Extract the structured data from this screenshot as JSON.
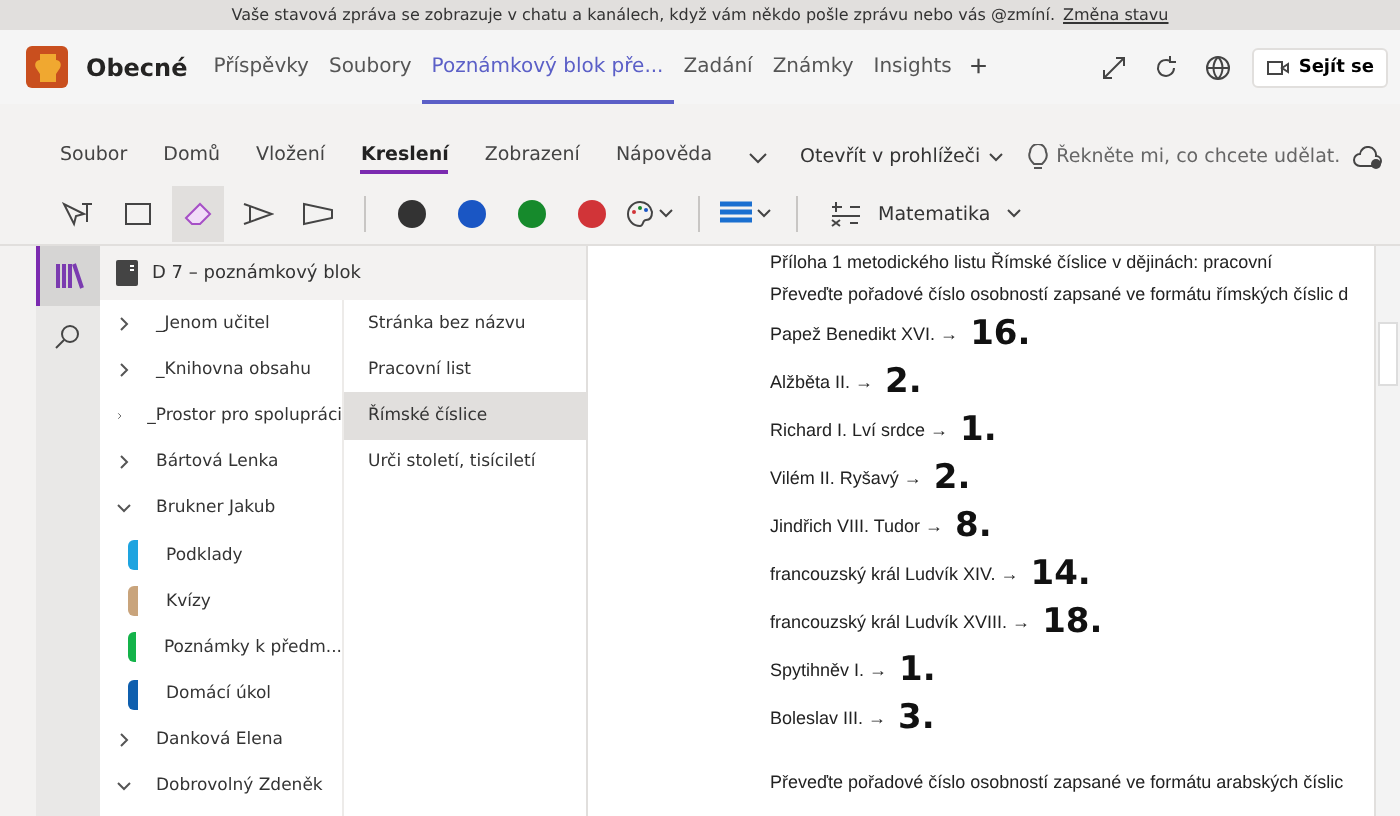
{
  "notice": {
    "text": "Vaše stavová zpráva se zobrazuje v chatu a kanálech, když vám někdo pošle zprávu nebo vás @zmíní.",
    "link": "Změna stavu"
  },
  "header": {
    "channel": "Obecné",
    "tabs": [
      {
        "label": "Příspěvky",
        "selected": false
      },
      {
        "label": "Soubory",
        "selected": false
      },
      {
        "label": "Poznámkový blok pře...",
        "selected": true
      },
      {
        "label": "Zadání",
        "selected": false
      },
      {
        "label": "Známky",
        "selected": false
      },
      {
        "label": "Insights",
        "selected": false
      }
    ],
    "add": "+",
    "meet": "Sejít se"
  },
  "ribbon": {
    "tabs": [
      {
        "label": "Soubor",
        "selected": false
      },
      {
        "label": "Domů",
        "selected": false
      },
      {
        "label": "Vložení",
        "selected": false
      },
      {
        "label": "Kreslení",
        "selected": true
      },
      {
        "label": "Zobrazení",
        "selected": false
      },
      {
        "label": "Nápověda",
        "selected": false
      }
    ],
    "open_in_browser": "Otevřít v prohlížeči",
    "tell_me": {
      "placeholder": "Řekněte mi, co chcete udělat."
    }
  },
  "toolbar": {
    "tools": [
      {
        "kind": "select",
        "selected": false
      },
      {
        "kind": "lasso",
        "selected": false
      },
      {
        "kind": "eraser",
        "selected": true
      },
      {
        "kind": "pen",
        "selected": false
      },
      {
        "kind": "highlighter",
        "selected": false
      }
    ],
    "pens": [
      {
        "color": "#333333"
      },
      {
        "color": "#1a56c4"
      },
      {
        "color": "#168a2c"
      },
      {
        "color": "#d13438"
      }
    ],
    "math": "Matematika"
  },
  "notebook": {
    "title": "D 7 – poznámkový blok",
    "sections": [
      {
        "label": "_Jenom učitel",
        "expanded": false
      },
      {
        "label": "_Knihovna obsahu",
        "expanded": false
      },
      {
        "label": "_Prostor pro spolupráci",
        "expanded": false
      },
      {
        "label": "Bártová Lenka",
        "expanded": false
      },
      {
        "label": "Brukner Jakub",
        "expanded": true,
        "children": [
          {
            "label": "Podklady",
            "color": "#1ea4e0"
          },
          {
            "label": "Kvízy",
            "color": "#c9a47c"
          },
          {
            "label": "Poznámky k předm...",
            "color": "#14b34a"
          },
          {
            "label": "Domácí úkol",
            "color": "#0f5fae"
          }
        ]
      },
      {
        "label": "Danková Elena",
        "expanded": false
      },
      {
        "label": "Dobrovolný Zdeněk",
        "expanded": true
      }
    ],
    "pages": [
      {
        "label": "Stránka bez názvu",
        "selected": false
      },
      {
        "label": "Pracovní list",
        "selected": false
      },
      {
        "label": "Římské číslice",
        "selected": true
      },
      {
        "label": "Urči století, tisíciletí",
        "selected": false
      }
    ]
  },
  "page": {
    "heading": "Příloha 1 metodického listu Římské číslice v dějinách: pracovní",
    "instruction": "Převeďte pořadové číslo osobností zapsané ve formátu římských číslic d",
    "items": [
      {
        "text": "Papež Benedikt XVI. →",
        "answer": "16."
      },
      {
        "text": "Alžběta II. →",
        "answer": "2."
      },
      {
        "text": "Richard I. Lví srdce →",
        "answer": "1."
      },
      {
        "text": "Vilém II. Ryšavý →",
        "answer": "2."
      },
      {
        "text": "Jindřich VIII. Tudor →",
        "answer": "8."
      },
      {
        "text": "francouzský král Ludvík XIV. →",
        "answer": "14."
      },
      {
        "text": "francouzský král Ludvík XVIII. →",
        "answer": "18."
      },
      {
        "text": "Spytihněv I. →",
        "answer": "1."
      },
      {
        "text": "Boleslav III. →",
        "answer": "3."
      }
    ],
    "instruction2": "Převeďte pořadové číslo osobností zapsané ve formátu arabských číslic"
  }
}
